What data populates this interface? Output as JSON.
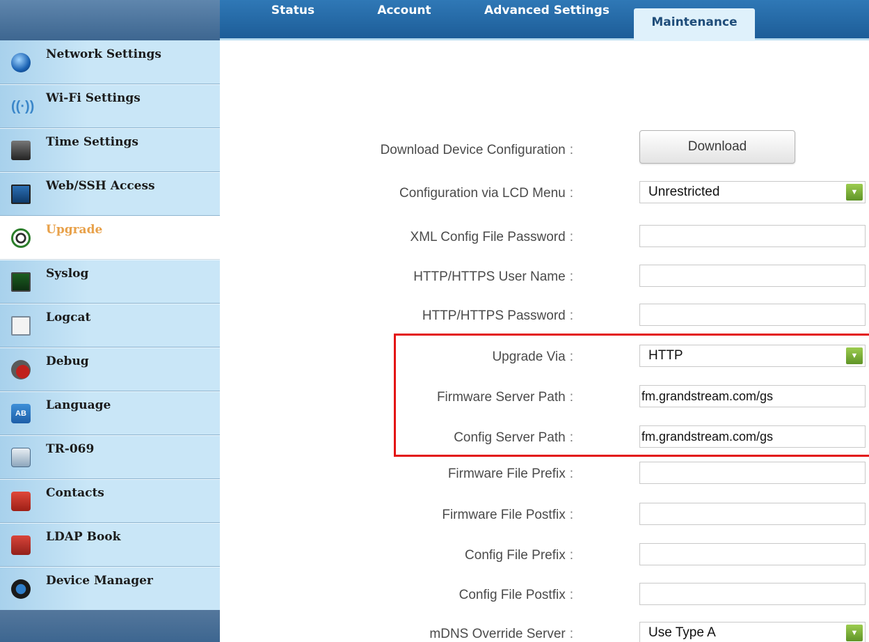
{
  "tabs": [
    {
      "label": "Status"
    },
    {
      "label": "Account"
    },
    {
      "label": "Advanced Settings"
    },
    {
      "label": "Maintenance"
    }
  ],
  "sidebar": {
    "items": [
      {
        "label": "Network Settings",
        "icon": "network-icon"
      },
      {
        "label": "Wi-Fi Settings",
        "icon": "wifi-icon"
      },
      {
        "label": "Time Settings",
        "icon": "clock-icon"
      },
      {
        "label": "Web/SSH Access",
        "icon": "monitor-network-icon"
      },
      {
        "label": "Upgrade",
        "icon": "upgrade-icon",
        "active": true
      },
      {
        "label": "Syslog",
        "icon": "syslog-icon"
      },
      {
        "label": "Logcat",
        "icon": "magnifier-icon"
      },
      {
        "label": "Debug",
        "icon": "bug-icon"
      },
      {
        "label": "Language",
        "icon": "language-icon",
        "icon_text": "AB"
      },
      {
        "label": "TR-069",
        "icon": "server-icon"
      },
      {
        "label": "Contacts",
        "icon": "phone-book-icon"
      },
      {
        "label": "LDAP Book",
        "icon": "ldap-icon"
      },
      {
        "label": "Device Manager",
        "icon": "tools-icon"
      }
    ]
  },
  "form": {
    "download_config": {
      "label": "Download Device Configuration",
      "button": "Download"
    },
    "config_lcd_menu": {
      "label": "Configuration via LCD Menu",
      "value": "Unrestricted"
    },
    "xml_password": {
      "label": "XML Config File Password",
      "value": ""
    },
    "http_user": {
      "label": "HTTP/HTTPS User Name",
      "value": ""
    },
    "http_password": {
      "label": "HTTP/HTTPS Password",
      "value": ""
    },
    "upgrade_via": {
      "label": "Upgrade Via",
      "value": "HTTP"
    },
    "firmware_server_path": {
      "label": "Firmware Server Path",
      "value": "fm.grandstream.com/gs"
    },
    "config_server_path": {
      "label": "Config Server Path",
      "value": "fm.grandstream.com/gs"
    },
    "firmware_prefix": {
      "label": "Firmware File Prefix",
      "value": ""
    },
    "firmware_postfix": {
      "label": "Firmware File Postfix",
      "value": ""
    },
    "config_prefix": {
      "label": "Config File Prefix",
      "value": ""
    },
    "config_postfix": {
      "label": "Config File Postfix",
      "value": ""
    },
    "mdns_override": {
      "label": "mDNS Override Server",
      "value": "Use Type A"
    }
  },
  "colors": {
    "tab_bar": "#2f78b6",
    "active_tab": "#dff1fb",
    "sidebar": "#c9e6f7",
    "active_nav_label": "#e8a14a",
    "highlight": "#e31212",
    "select_arrow": "#7db23b"
  }
}
